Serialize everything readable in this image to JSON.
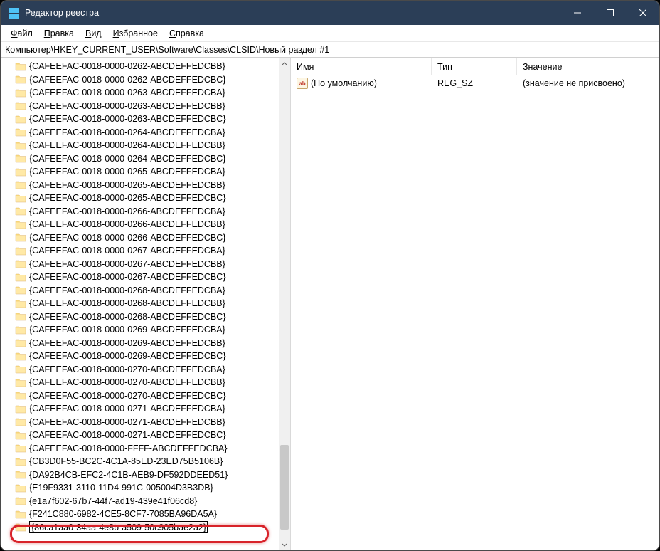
{
  "window": {
    "title": "Редактор реестра"
  },
  "menu": {
    "file": "Файл",
    "edit": "Правка",
    "view": "Вид",
    "favorites": "Избранное",
    "help": "Справка"
  },
  "address": "Компьютер\\HKEY_CURRENT_USER\\Software\\Classes\\CLSID\\Новый раздел #1",
  "tree_items": [
    "{CAFEEFAC-0018-0000-0262-ABCDEFFEDCBB}",
    "{CAFEEFAC-0018-0000-0262-ABCDEFFEDCBC}",
    "{CAFEEFAC-0018-0000-0263-ABCDEFFEDCBA}",
    "{CAFEEFAC-0018-0000-0263-ABCDEFFEDCBB}",
    "{CAFEEFAC-0018-0000-0263-ABCDEFFEDCBC}",
    "{CAFEEFAC-0018-0000-0264-ABCDEFFEDCBA}",
    "{CAFEEFAC-0018-0000-0264-ABCDEFFEDCBB}",
    "{CAFEEFAC-0018-0000-0264-ABCDEFFEDCBC}",
    "{CAFEEFAC-0018-0000-0265-ABCDEFFEDCBA}",
    "{CAFEEFAC-0018-0000-0265-ABCDEFFEDCBB}",
    "{CAFEEFAC-0018-0000-0265-ABCDEFFEDCBC}",
    "{CAFEEFAC-0018-0000-0266-ABCDEFFEDCBA}",
    "{CAFEEFAC-0018-0000-0266-ABCDEFFEDCBB}",
    "{CAFEEFAC-0018-0000-0266-ABCDEFFEDCBC}",
    "{CAFEEFAC-0018-0000-0267-ABCDEFFEDCBA}",
    "{CAFEEFAC-0018-0000-0267-ABCDEFFEDCBB}",
    "{CAFEEFAC-0018-0000-0267-ABCDEFFEDCBC}",
    "{CAFEEFAC-0018-0000-0268-ABCDEFFEDCBA}",
    "{CAFEEFAC-0018-0000-0268-ABCDEFFEDCBB}",
    "{CAFEEFAC-0018-0000-0268-ABCDEFFEDCBC}",
    "{CAFEEFAC-0018-0000-0269-ABCDEFFEDCBA}",
    "{CAFEEFAC-0018-0000-0269-ABCDEFFEDCBB}",
    "{CAFEEFAC-0018-0000-0269-ABCDEFFEDCBC}",
    "{CAFEEFAC-0018-0000-0270-ABCDEFFEDCBA}",
    "{CAFEEFAC-0018-0000-0270-ABCDEFFEDCBB}",
    "{CAFEEFAC-0018-0000-0270-ABCDEFFEDCBC}",
    "{CAFEEFAC-0018-0000-0271-ABCDEFFEDCBA}",
    "{CAFEEFAC-0018-0000-0271-ABCDEFFEDCBB}",
    "{CAFEEFAC-0018-0000-0271-ABCDEFFEDCBC}",
    "{CAFEEFAC-0018-0000-FFFF-ABCDEFFEDCBA}",
    "{CB3D0F55-BC2C-4C1A-85ED-23ED75B5106B}",
    "{DA92B4CB-EFC2-4C1B-AEB9-DF592DDEED51}",
    "{E19F9331-3110-11D4-991C-005004D3B3DB}",
    "{e1a7f602-67b7-44f7-ad19-439e41f06cd8}",
    "{F241C880-6982-4CE5-8CF7-7085BA96DA5A}"
  ],
  "edit_value": "{86ca1aa0-34aa-4e8b-a509-50c905bae2a2}",
  "list": {
    "headers": {
      "name": "Имя",
      "type": "Тип",
      "value": "Значение"
    },
    "rows": [
      {
        "icon": "ab",
        "name": "(По умолчанию)",
        "type": "REG_SZ",
        "value": "(значение не присвоено)"
      }
    ]
  }
}
